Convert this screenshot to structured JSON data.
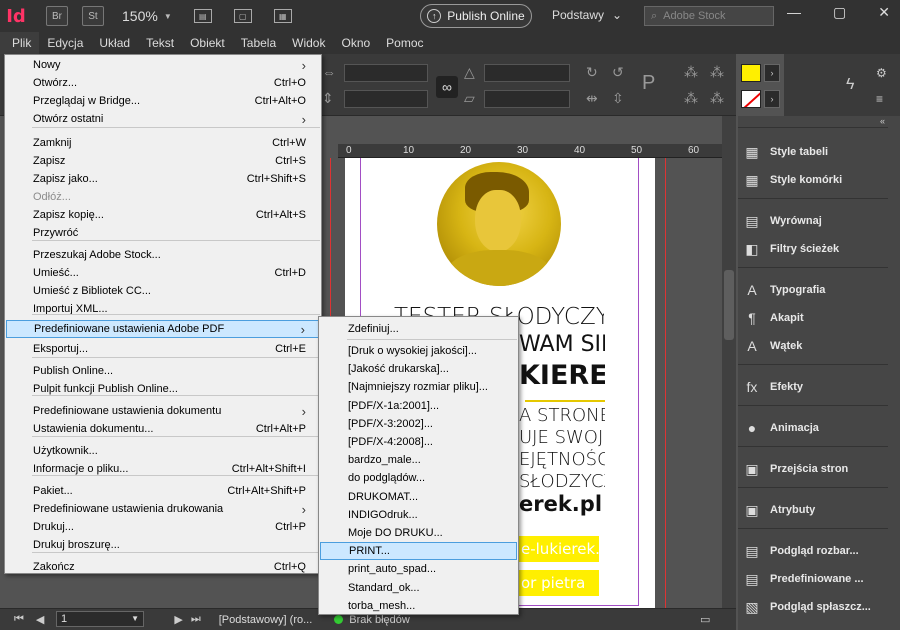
{
  "appbar": {
    "logo": "Id",
    "bridge": "Br",
    "stock": "St",
    "zoom": "150%",
    "publish_label": "Publish Online",
    "workspace": "Podstawy",
    "search_placeholder": "Adobe Stock"
  },
  "menubar": [
    "Plik",
    "Edycja",
    "Układ",
    "Tekst",
    "Obiekt",
    "Tabela",
    "Widok",
    "Okno",
    "Pomoc"
  ],
  "file_menu": [
    {
      "label": "Nowy",
      "shortcut": "",
      "submenu": true
    },
    {
      "label": "Otwórz...",
      "shortcut": "Ctrl+O"
    },
    {
      "label": "Przeglądaj w Bridge...",
      "shortcut": "Ctrl+Alt+O"
    },
    {
      "label": "Otwórz ostatni",
      "shortcut": "",
      "submenu": true
    },
    {
      "label": "Zamknij",
      "shortcut": "Ctrl+W"
    },
    {
      "label": "Zapisz",
      "shortcut": "Ctrl+S"
    },
    {
      "label": "Zapisz jako...",
      "shortcut": "Ctrl+Shift+S"
    },
    {
      "label": "Odłóż...",
      "shortcut": "",
      "disabled": true
    },
    {
      "label": "Zapisz kopię...",
      "shortcut": "Ctrl+Alt+S"
    },
    {
      "label": "Przywróć",
      "shortcut": ""
    },
    {
      "label": "Przeszukaj Adobe Stock...",
      "shortcut": ""
    },
    {
      "label": "Umieść...",
      "shortcut": "Ctrl+D"
    },
    {
      "label": "Umieść z Bibliotek CC...",
      "shortcut": ""
    },
    {
      "label": "Importuj XML...",
      "shortcut": ""
    },
    {
      "label": "Predefiniowane ustawienia Adobe PDF",
      "shortcut": "",
      "submenu": true,
      "highlighted": true
    },
    {
      "label": "Eksportuj...",
      "shortcut": "Ctrl+E"
    },
    {
      "label": "Publish Online...",
      "shortcut": ""
    },
    {
      "label": "Pulpit funkcji Publish Online...",
      "shortcut": ""
    },
    {
      "label": "Predefiniowane ustawienia dokumentu",
      "shortcut": "",
      "submenu": true
    },
    {
      "label": "Ustawienia dokumentu...",
      "shortcut": "Ctrl+Alt+P"
    },
    {
      "label": "Użytkownik...",
      "shortcut": ""
    },
    {
      "label": "Informacje o pliku...",
      "shortcut": "Ctrl+Alt+Shift+I"
    },
    {
      "label": "Pakiet...",
      "shortcut": "Ctrl+Alt+Shift+P"
    },
    {
      "label": "Predefiniowane ustawienia drukowania",
      "shortcut": "",
      "submenu": true
    },
    {
      "label": "Drukuj...",
      "shortcut": "Ctrl+P"
    },
    {
      "label": "Drukuj broszurę...",
      "shortcut": ""
    },
    {
      "label": "Zakończ",
      "shortcut": "Ctrl+Q"
    }
  ],
  "pdf_submenu": [
    {
      "label": "Zdefiniuj..."
    },
    {
      "label": "[Druk o wysokiej jakości]..."
    },
    {
      "label": "[Jakość drukarska]..."
    },
    {
      "label": "[Najmniejszy rozmiar pliku]..."
    },
    {
      "label": "[PDF/X-1a:2001]..."
    },
    {
      "label": "[PDF/X-3:2002]..."
    },
    {
      "label": "[PDF/X-4:2008]..."
    },
    {
      "label": "bardzo_male..."
    },
    {
      "label": "do podglądów..."
    },
    {
      "label": "DRUKOMAT..."
    },
    {
      "label": "INDIGOdruk..."
    },
    {
      "label": "Moje DO DRUKU..."
    },
    {
      "label": "PRINT...",
      "highlighted": true
    },
    {
      "label": "print_auto_spad..."
    },
    {
      "label": "Standard_ok..."
    },
    {
      "label": "torba_mesh..."
    }
  ],
  "ruler": [
    "0",
    "10",
    "20",
    "30",
    "40",
    "50",
    "60"
  ],
  "document": {
    "line1": "TESTER SŁODYCZY",
    "line2": "WAM SIĘ",
    "line3": "KIEREK",
    "line4": "A STRONĘ",
    "line5": "UJE SWOJE",
    "line6": "EJĘTNOŚCI",
    "line7": "SŁODZYCZY",
    "line8": "erek.pl",
    "bar1": "e-lukierek.pl",
    "bar2": "or pietra"
  },
  "right_panel": [
    {
      "label": "Style tabeli",
      "icon": "table-style-icon",
      "glyph": "▦"
    },
    {
      "label": "Style komórki",
      "icon": "cell-style-icon",
      "glyph": "▦"
    },
    {
      "label": "Wyrównaj",
      "icon": "align-icon",
      "glyph": "▤"
    },
    {
      "label": "Filtry ścieżek",
      "icon": "pathfinder-icon",
      "glyph": "◧"
    },
    {
      "label": "Typografia",
      "icon": "glyph-icon",
      "glyph": "A"
    },
    {
      "label": "Akapit",
      "icon": "paragraph-icon",
      "glyph": "¶"
    },
    {
      "label": "Wątek",
      "icon": "character-icon",
      "glyph": "A"
    },
    {
      "label": "Efekty",
      "icon": "effects-icon",
      "glyph": "fx"
    },
    {
      "label": "Animacja",
      "icon": "animation-icon",
      "glyph": "●"
    },
    {
      "label": "Przejścia stron",
      "icon": "page-transition-icon",
      "glyph": "▣"
    },
    {
      "label": "Atrybuty",
      "icon": "attributes-icon",
      "glyph": "▣"
    },
    {
      "label": "Podgląd rozbar...",
      "icon": "separations-icon",
      "glyph": "▤"
    },
    {
      "label": "Predefiniowane ...",
      "icon": "presets-icon",
      "glyph": "▤"
    },
    {
      "label": "Podgląd spłaszcz...",
      "icon": "flattener-icon",
      "glyph": "▧"
    }
  ],
  "status": {
    "page": "1",
    "master": "[Podstawowy] (ro...",
    "preflight": "Brak błędów"
  },
  "colors": {
    "accent_yellow": "#ffef00",
    "menu_highlight": "#cce8ff",
    "indesign_pink": "#ff3366"
  }
}
